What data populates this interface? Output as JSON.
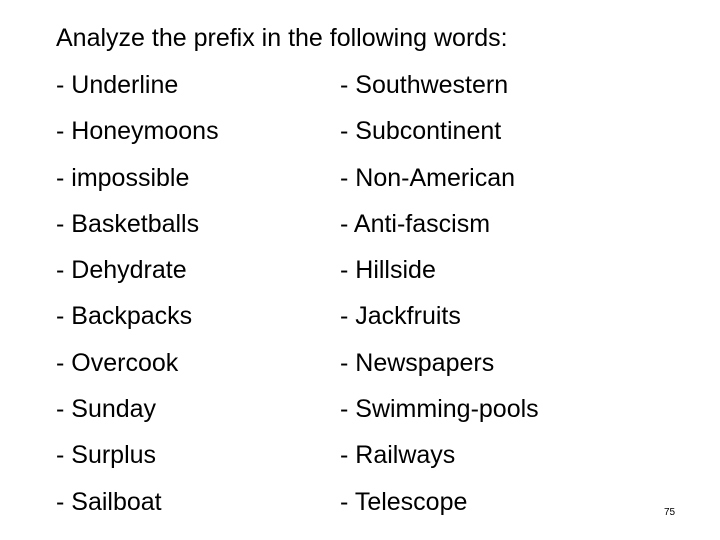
{
  "slide": {
    "title": "Analyze the prefix in the following words:",
    "left_column": [
      "- Underline",
      "- Honeymoons",
      "- impossible",
      "- Basketballs",
      "- Dehydrate",
      "- Backpacks",
      "- Overcook",
      "- Sunday",
      "- Surplus",
      "- Sailboat"
    ],
    "right_column": [
      "- Southwestern",
      "- Subcontinent",
      "- Non-American",
      "- Anti-fascism",
      "- Hillside",
      "- Jackfruits",
      "- Newspapers",
      "- Swimming-pools",
      "- Railways",
      "- Telescope"
    ],
    "page_number": "75"
  }
}
